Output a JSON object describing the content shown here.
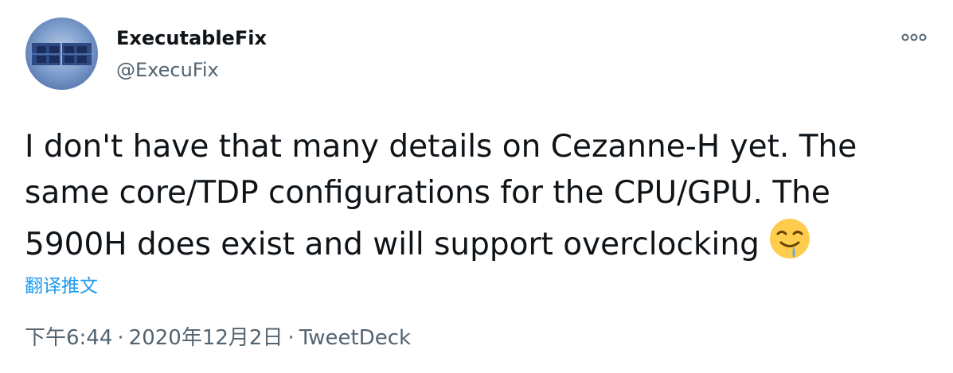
{
  "author": {
    "display_name": "ExecutableFix",
    "handle": "@ExecuFix"
  },
  "tweet": {
    "lines": [
      "I don't have that many details on Cezanne-H yet. The",
      "same core/TDP configurations for the CPU/GPU. The",
      "5900H does exist and will support overclocking"
    ],
    "emoji": "drooling-face-emoji"
  },
  "translate_label": "翻译推文",
  "meta": {
    "time": "下午6:44",
    "separator": "·",
    "date": "2020年12月2日",
    "source": "TweetDeck"
  },
  "icons": {
    "more": "more-options-icon"
  },
  "colors": {
    "text": "#0f1419",
    "secondary": "#536471",
    "link": "#1d9bf0"
  }
}
